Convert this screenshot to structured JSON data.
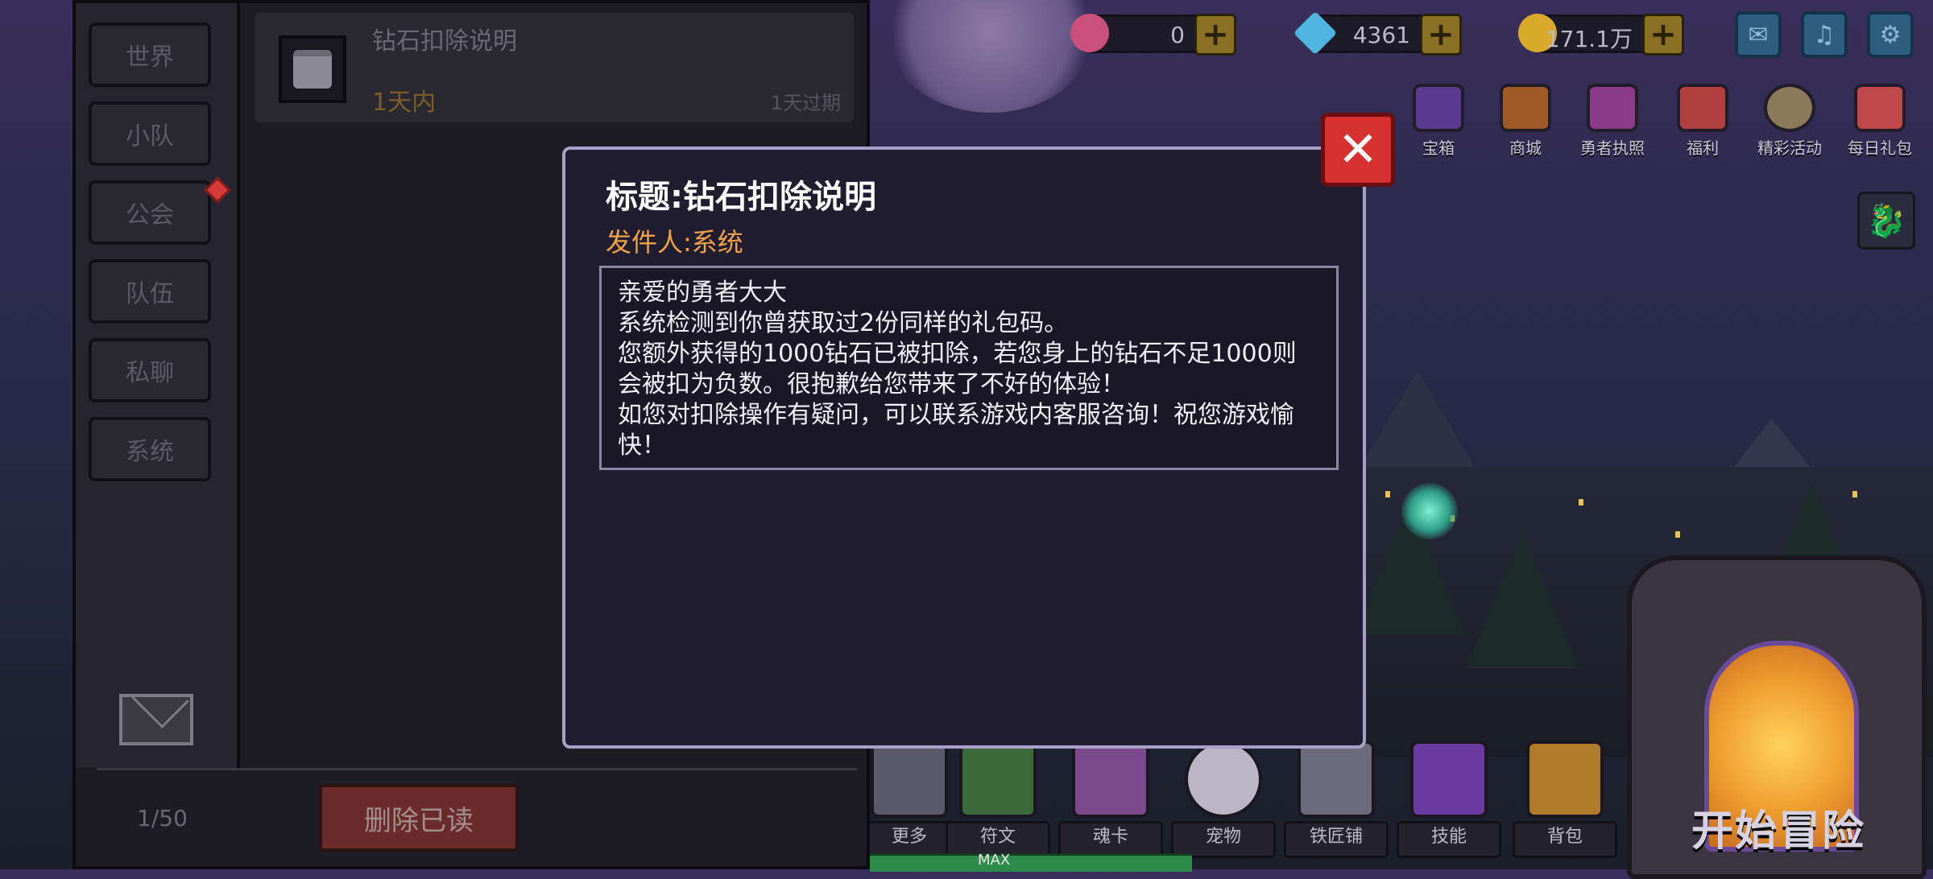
{
  "mail": {
    "tabs": [
      "世界",
      "小队",
      "公会",
      "队伍",
      "私聊",
      "系统"
    ],
    "item": {
      "title": "钻石扣除说明",
      "time_left": "1天内",
      "expire": "1天过期"
    },
    "count": "1/50",
    "delete_read_label": "删除已读"
  },
  "resources": [
    {
      "name": "pink-gem",
      "value": "0",
      "color": "#c9507a"
    },
    {
      "name": "diamond",
      "value": "4361",
      "color": "#4fb6e0"
    },
    {
      "name": "gold-coin",
      "value": "171.1万",
      "color": "#d8a92a"
    }
  ],
  "hud_buttons": [
    "mail-icon",
    "sound-icon",
    "settings-icon"
  ],
  "top_menu": [
    "宝箱",
    "商城",
    "勇者执照",
    "福利",
    "精彩活动",
    "每日礼包"
  ],
  "bottom_menu": [
    "更多",
    "符文",
    "魂卡",
    "宠物",
    "铁匠铺",
    "技能",
    "背包"
  ],
  "start_label": "开始冒险",
  "max_label": "MAX",
  "dialog": {
    "title": "标题:钻石扣除说明",
    "sender": "发件人:系统",
    "body": [
      "亲爱的勇者大大",
      "系统检测到你曾获取过2份同样的礼包码。",
      "您额外获得的1000钻石已被扣除，若您身上的钻石不足1000则会被扣为负数。很抱歉给您带来了不好的体验！",
      "如您对扣除操作有疑问，可以联系游戏内客服咨询！祝您游戏愉快！"
    ],
    "close_symbol": "✕"
  }
}
